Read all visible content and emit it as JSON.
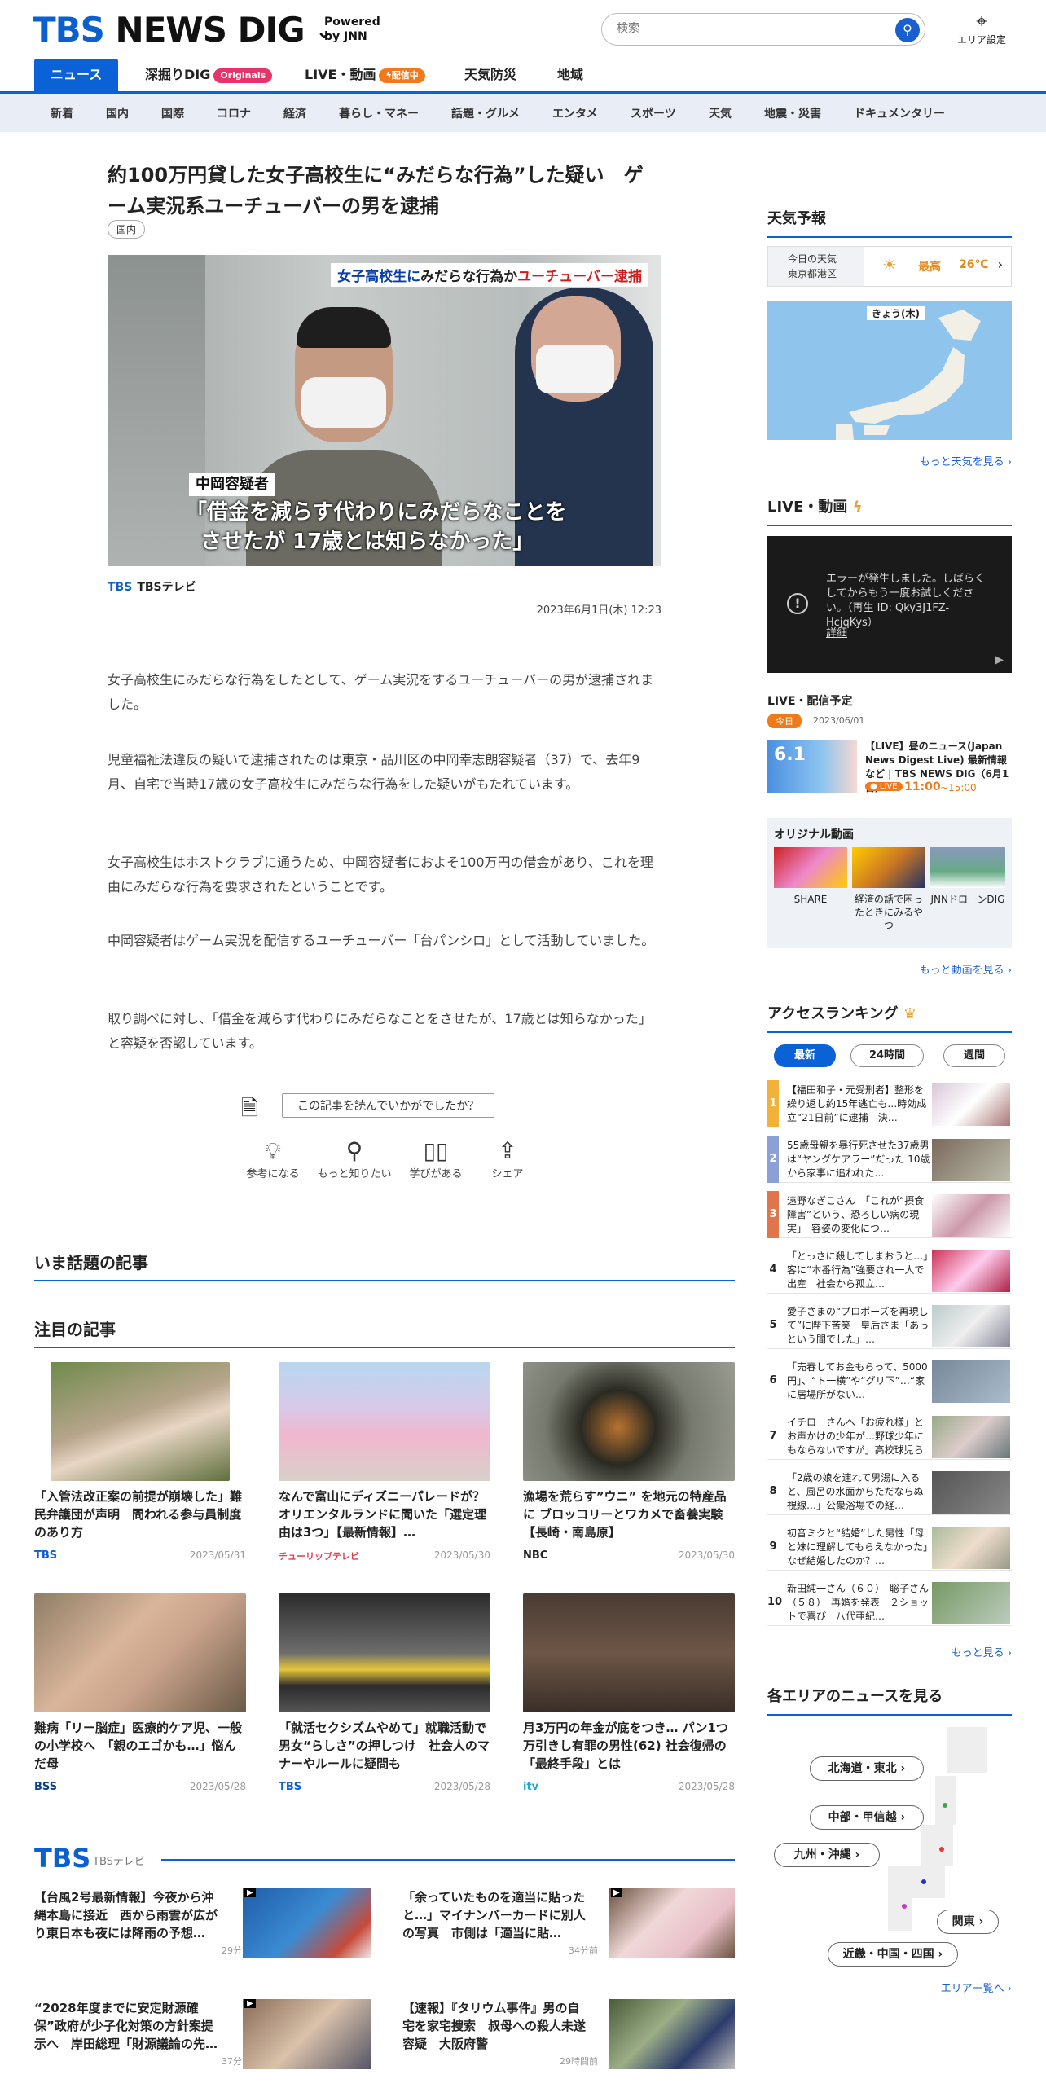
{
  "header": {
    "brand_tbs": "TBS",
    "brand_news": "NEWS",
    "brand_dig": "DIG",
    "powered1": "Powered",
    "powered2": "by JNN",
    "search_placeholder": "検索",
    "area_label": "エリア設定"
  },
  "nav": {
    "items": [
      "ニュース",
      "深掘りDIG",
      "LIVE・動画",
      "天気防災",
      "地域"
    ],
    "originals_badge": "Originals",
    "live_badge": "配信中"
  },
  "subnav": [
    "新着",
    "国内",
    "国際",
    "コロナ",
    "経済",
    "暮らし・マネー",
    "話題・グルメ",
    "エンタメ",
    "スポーツ",
    "天気",
    "地震・災害",
    "ドキュメンタリー"
  ],
  "article": {
    "title": "約100万円貸した女子高校生に“みだらな行為”した疑い　ゲーム実況系ユーチューバーの男を逮捕",
    "category": "国内",
    "image_caption_top_blue": "女子高校生に",
    "image_caption_top_black": "みだらな行為か",
    "image_caption_top_red": "ユーチューバー逮捕",
    "image_caption_name": "中岡容疑者",
    "image_caption_quote1": "「借金を減らす代わりにみだらなことを",
    "image_caption_quote2": "させたが 17歳とは知らなかった」",
    "source_logo": "TBS",
    "source_name": "TBSテレビ",
    "date": "2023年6月1日(木) 12:23",
    "paragraphs": [
      "女子高校生にみだらな行為をしたとして、ゲーム実況をするユーチューバーの男が逮捕されました。",
      "児童福祉法違反の疑いで逮捕されたのは東京・品川区の中岡幸志朗容疑者（37）で、去年9月、自宅で当時17歳の女子高校生にみだらな行為をした疑いがもたれています。",
      "女子高校生はホストクラブに通うため、中岡容疑者におよそ100万円の借金があり、これを理由にみだらな行為を要求されたということです。",
      "中岡容疑者はゲーム実況を配信するユーチューバー「台パンシロ」として活動していました。",
      "取り調べに対し、「借金を減らす代わりにみだらなことをさせたが、17歳とは知らなかった」と容疑を否認しています。"
    ],
    "feedback_prompt": "この記事を読んでいかがでしたか？",
    "feedback": [
      "参考になる",
      "もっと知りたい",
      "学びがある",
      "シェア"
    ]
  },
  "sections": {
    "trending": "いま話題の記事",
    "featured": "注目の記事"
  },
  "featured": [
    {
      "title": "「入管法改正案の前提が崩壊した」難民弁護団が声明　問われる参与員制度のあり方",
      "source": "TBS",
      "date": "2023/05/31"
    },
    {
      "title": "なんで富山にディズニーパレードが？オリエンタルランドに聞いた「選定理由は3つ」【最新情報】…",
      "source": "チューリップテレビ",
      "date": "2023/05/30"
    },
    {
      "title": "漁場を荒らす”ウニ” を地元の特産品に ブロッコリーとワカメで畜養実験【長崎・南島原】",
      "source": "NBC",
      "date": "2023/05/30"
    },
    {
      "title": "難病「リー脳症」医療的ケア児、一般の小学校へ　「親のエゴかも…」悩んだ母",
      "source": "BSS",
      "date": "2023/05/28"
    },
    {
      "title": "「就活セクシズムやめて」就職活動で男女“らしさ”の押しつけ　社会人のマナーやルールに疑問も",
      "source": "TBS",
      "date": "2023/05/28"
    },
    {
      "title": "月3万円の年金が底をつき… パン1つ万引きし有罪の男性(62) 社会復帰の「最終手段」とは",
      "source": "itv",
      "date": "2023/05/28"
    }
  ],
  "tbs_block": {
    "logo": "TBS",
    "label": "TBSテレビ",
    "items": [
      {
        "title": "【台風2号最新情報】今夜から沖縄本島に接近　西から雨雲が広がり東日本も夜には降雨の予想…",
        "time": "29分前"
      },
      {
        "title": "「余っていたものを適当に貼ったと…」マイナンバーカードに別人の写真　市側は「適当に貼…",
        "time": "34分前"
      },
      {
        "title": "“2028年度までに安定財源確保”政府が少子化対策の方針案提示へ　岸田総理「財源議論の先…",
        "time": "37分前"
      },
      {
        "title": "【速報】『タリウム事件』男の自宅を家宅捜索　叔母への殺人未遂容疑　大阪府警",
        "time": "29時間前"
      }
    ]
  },
  "sidebar": {
    "weather_title": "天気予報",
    "weather_today": "今日の天気",
    "weather_loc": "東京都港区",
    "weather_high_label": "最高",
    "weather_high": "26℃",
    "weather_map_label": "きょう(木)",
    "weather_more": "もっと天気を見る",
    "live_title": "LIVE・動画",
    "video_error": "エラーが発生しました。しばらくしてからもう一度お試しください。（再生 ID: Qky3J1FZ-HcjqKys）",
    "video_error_link": "詳細",
    "live_schedule_title": "LIVE・配信予定",
    "today_pill": "今日",
    "schedule_date": "2023/06/01",
    "schedule_thumb_date": "6.1",
    "schedule_title": "【LIVE】昼のニュース(Japan News Digest Live) 最新情報など | TBS NEWS DIG（6月1日）",
    "schedule_live": "LIVE",
    "schedule_time": "11:00",
    "schedule_end": "~15:00",
    "original_title": "オリジナル動画",
    "originals": [
      {
        "label": "SHARE"
      },
      {
        "label": "経済の話で困ったときにみるやつ"
      },
      {
        "label": "JNNドローンDIG"
      }
    ],
    "videos_more": "もっと動画を見る",
    "ranking_title": "アクセスランキング",
    "ranking_tabs": [
      "最新",
      "24時間",
      "週間"
    ],
    "ranking": [
      {
        "n": "1",
        "t": "【福田和子・元受刑者】整形を繰り返し約15年逃亡も…時効成立“21日前”に逮捕　決…"
      },
      {
        "n": "2",
        "t": "55歳母親を暴行死させた37歳男は“ヤングケアラー”だった 10歳から家事に追われた…"
      },
      {
        "n": "3",
        "t": "遠野なぎこさん　「これが“摂食障害”という、恐ろしい病の現実」　容姿の変化につ…"
      },
      {
        "n": "4",
        "t": "「とっさに殺してしまおうと…」客に“本番行為”強要され一人で出産　社会から孤立…"
      },
      {
        "n": "5",
        "t": "愛子さまの“プロポーズを再現して”に陛下苦笑　皇后さま「あっという間でした」…"
      },
      {
        "n": "6",
        "t": "「売春してお金もらって、5000円」、“ト一横”や“グリ下”…“家に居場所がない…"
      },
      {
        "n": "7",
        "t": "イチローさんへ「お疲れ様」とお声かけの少年が…野球少年にもならないですが」高校球児らの質…"
      },
      {
        "n": "8",
        "t": "「2歳の娘を連れて男湯に入ると、風呂の水面からただならぬ視線…」公衆浴場での経…"
      },
      {
        "n": "9",
        "t": "初音ミクと“結婚”した男性「母と妹に理解してもらえなかった」なぜ結婚したのか？…"
      },
      {
        "n": "10",
        "t": "新田純一さん（６０）　聡子さん（５８）　再婚を発表　２ショットで喜び　八代亜紀…"
      }
    ],
    "ranking_more": "もっと見る",
    "areas_title": "各エリアのニュースを見る",
    "areas": [
      "北海道・東北",
      "中部・甲信越",
      "九州・沖縄",
      "関東",
      "近畿・中国・四国"
    ],
    "areas_more": "エリア一覧へ"
  }
}
